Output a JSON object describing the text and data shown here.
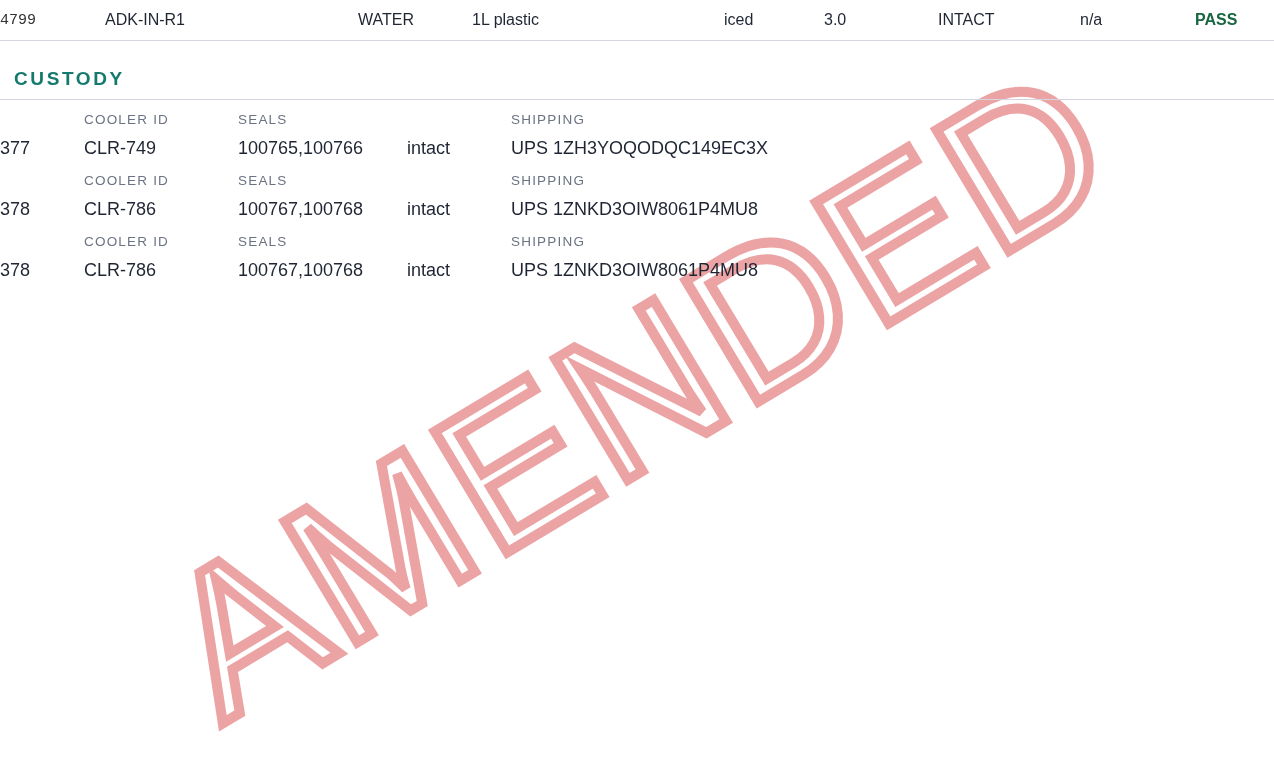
{
  "sample_row": {
    "cells": [
      "4799",
      "ADK-IN-R1",
      "WATER",
      "1L plastic",
      "iced",
      "3.0",
      "INTACT",
      "n/a"
    ],
    "result": "PASS"
  },
  "section": {
    "title": "CUSTODY"
  },
  "coolers": [
    {
      "row_id": "377",
      "labels": [
        "COOLER ID",
        "SEALS",
        "SHIPPING"
      ],
      "cooler_id": "CLR-749",
      "seals": "100765,100766",
      "seal_status": "intact",
      "shipping": "UPS 1ZH3YOQODQC149EC3X"
    },
    {
      "row_id": "378",
      "labels": [
        "COOLER ID",
        "SEALS",
        "SHIPPING"
      ],
      "cooler_id": "CLR-786",
      "seals": "100767,100768",
      "seal_status": "intact",
      "shipping": "UPS 1ZNKD3OIW8061P4MU8"
    },
    {
      "row_id": "378",
      "labels": [
        "COOLER ID",
        "SEALS",
        "SHIPPING"
      ],
      "cooler_id": "CLR-786",
      "seals": "100767,100768",
      "seal_status": "intact",
      "shipping": "UPS 1ZNKD3OIW8061P4MU8"
    }
  ],
  "stamp": "AMENDED"
}
